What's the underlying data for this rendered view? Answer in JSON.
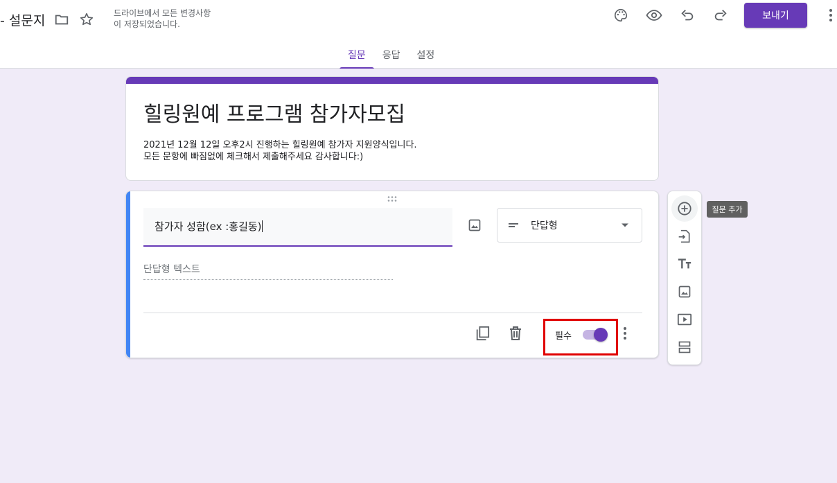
{
  "header": {
    "doc_title": "- 설문지",
    "save_status": "드라이브에서 모든 변경사항\n이 저장되었습니다.",
    "send_label": "보내기",
    "icons": [
      "folder-icon",
      "star-icon",
      "palette-icon",
      "eye-icon",
      "undo-icon",
      "redo-icon",
      "more-vert-icon"
    ]
  },
  "tabs": [
    {
      "label": "질문",
      "active": true
    },
    {
      "label": "응답",
      "active": false
    },
    {
      "label": "설정",
      "active": false
    }
  ],
  "form": {
    "title": "힐링원예 프로그램 참가자모집",
    "description_line1": "2021년 12월 12일 오후2시 진행하는 힐링원예 참가자 지원양식입니다.",
    "description_line2": "모든 문항에 빠짐없에 체크해서 제출해주세요 감사합니다:)"
  },
  "question": {
    "text": "참가자 성함(ex :홍길동)",
    "type_label": "단답형",
    "answer_placeholder": "단답형 텍스트",
    "required_label": "필수",
    "required_on": true
  },
  "toolbar": {
    "tooltip": "질문 추가",
    "icons": [
      "add-circle-icon",
      "import-icon",
      "title-icon",
      "image-icon",
      "video-icon",
      "section-icon"
    ]
  },
  "colors": {
    "accent": "#673ab7",
    "background": "#f0ebf8",
    "question_bar": "#4285f4",
    "highlight_box": "#e00000"
  }
}
